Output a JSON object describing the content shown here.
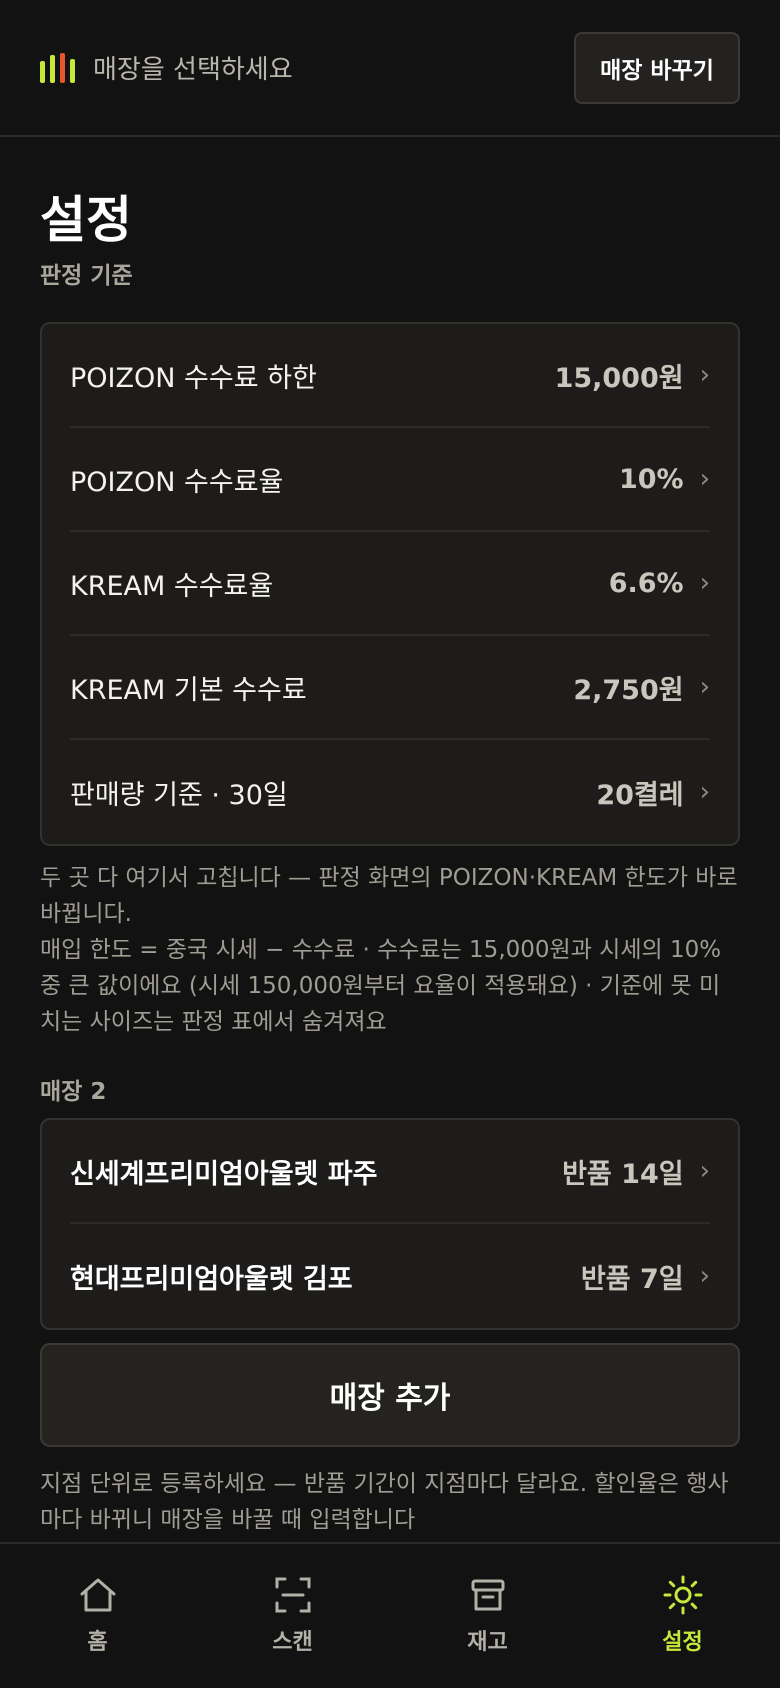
{
  "header": {
    "store_prompt": "매장을 선택하세요",
    "change_store_label": "매장 바꾸기"
  },
  "page": {
    "title": "설정"
  },
  "judgement": {
    "section_label": "판정 기준",
    "rows": [
      {
        "label": "POIZON 수수료 하한",
        "value": "15,000원"
      },
      {
        "label": "POIZON 수수료율",
        "value": "10%"
      },
      {
        "label": "KREAM 수수료율",
        "value": "6.6%"
      },
      {
        "label": "KREAM 기본 수수료",
        "value": "2,750원"
      },
      {
        "label": "판매량 기준 · 30일",
        "value": "20켤레"
      }
    ],
    "help_line1": "두 곳 다 여기서 고칩니다 — 판정 화면의 POIZON·KREAM 한도가 바로 바뀝니다.",
    "help_line2": "매입 한도 = 중국 시세 − 수수료 · 수수료는 15,000원과 시세의 10% 중 큰 값이에요 (시세 150,000원부터 요율이 적용돼요) · 기준에 못 미치는 사이즈는 판정 표에서 숨겨져요"
  },
  "stores": {
    "section_label": "매장 2",
    "rows": [
      {
        "name": "신세계프리미엄아울렛 파주",
        "return_period": "반품 14일"
      },
      {
        "name": "현대프리미엄아울렛 김포",
        "return_period": "반품 7일"
      }
    ],
    "add_store_label": "매장 추가",
    "help_text": "지점 단위로 등록하세요 — 반품 기간이 지점마다 달라요. 할인율은 행사마다 바뀌니 매장을 바꿀 때 입력합니다"
  },
  "nav": {
    "items": [
      {
        "label": "홈",
        "icon": "home-icon"
      },
      {
        "label": "스캔",
        "icon": "scan-icon"
      },
      {
        "label": "재고",
        "icon": "inventory-box-icon"
      },
      {
        "label": "설정",
        "icon": "settings-sun-icon",
        "active": true
      }
    ]
  },
  "colors": {
    "accent": "#c6e83b",
    "logo_orange": "#e2572c",
    "background": "#121212",
    "card": "#1d1c1a"
  }
}
